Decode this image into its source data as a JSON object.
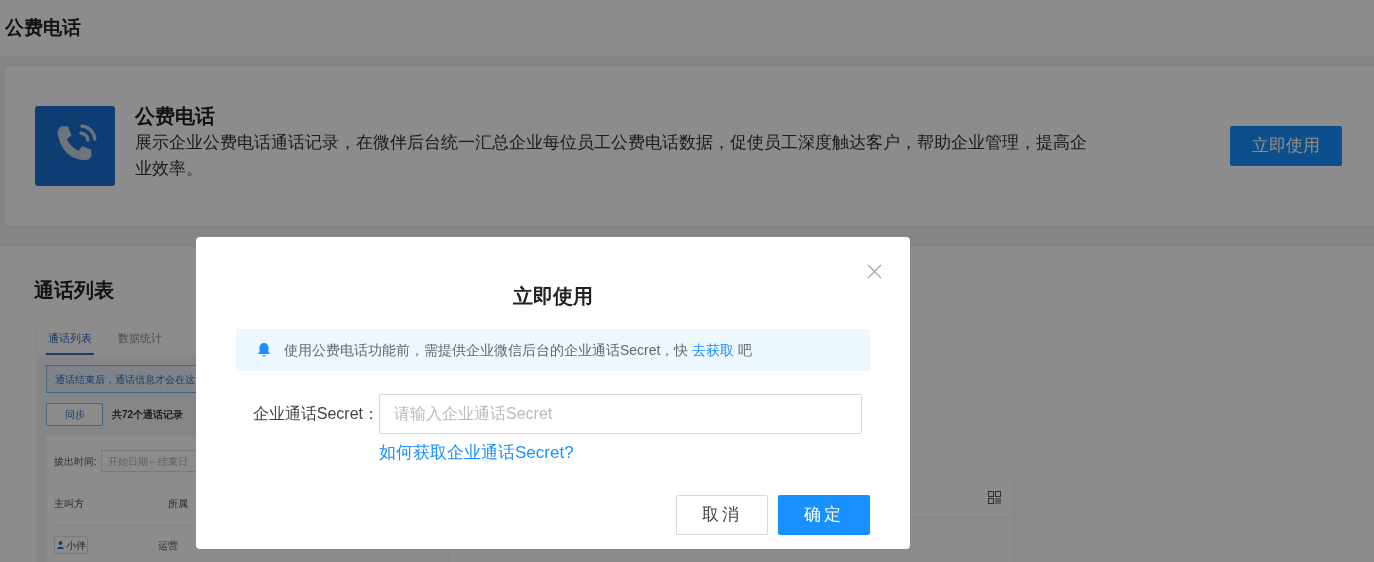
{
  "page_title": "公费电话",
  "feature": {
    "title": "公费电话",
    "description": "展示企业公费电话通话记录，在微伴后台统一汇总企业每位员工公费电话数据，促使员工深度触达客户，帮助企业管理，提高企业效率。",
    "action": "立即使用"
  },
  "section": {
    "title": "通话列表",
    "preview": {
      "tabs": [
        {
          "label": "通话列表",
          "selected": true
        },
        {
          "label": "数据统计",
          "selected": false
        }
      ],
      "notice": "通话结束后，通话信息才会在这",
      "sync_button": "同步",
      "record_count": "共72个通话记录",
      "filter_label": "拔出时间:",
      "date_placeholder": "开始日期～结束日",
      "columns": [
        "主叫方",
        "所属"
      ],
      "rows": [
        {
          "caller": "小伴",
          "department": "运营"
        }
      ]
    }
  },
  "dialog": {
    "title": "立即使用",
    "alert_text": "使用公费电话功能前，需提供企业微信后台的企业通话Secret，快",
    "alert_link": "去获取",
    "alert_suffix": "吧",
    "field_label": "企业通话Secret：",
    "placeholder": "请输入企业通话Secret",
    "help_link": "如何获取企业通话Secret?",
    "cancel": "取消",
    "confirm": "确定"
  }
}
